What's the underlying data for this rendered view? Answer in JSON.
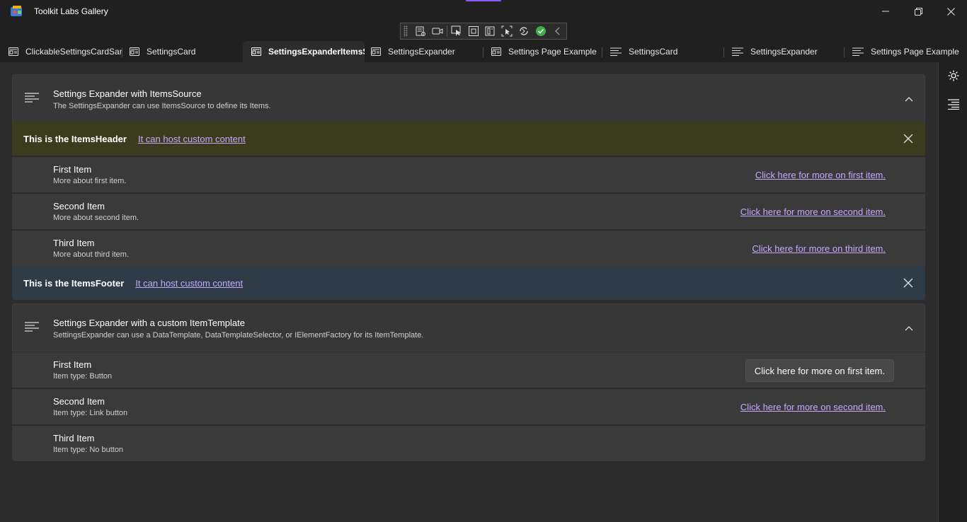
{
  "window": {
    "title": "Toolkit Labs Gallery"
  },
  "tabs": [
    {
      "label": "ClickableSettingsCardSar"
    },
    {
      "label": "SettingsCard"
    },
    {
      "label": "SettingsExpanderItemsS"
    },
    {
      "label": "SettingsExpander"
    },
    {
      "label": "Settings Page Example"
    },
    {
      "label": "SettingsCard"
    },
    {
      "label": "SettingsExpander"
    },
    {
      "label": "Settings Page Example"
    }
  ],
  "expander1": {
    "title": "Settings Expander with ItemsSource",
    "description": "The SettingsExpander can use ItemsSource to define its Items.",
    "header_banner": {
      "strong": "This is the ItemsHeader",
      "link": "It can host custom content"
    },
    "items": [
      {
        "title": "First Item",
        "desc": "More about first item.",
        "link": "Click here for more on first item."
      },
      {
        "title": "Second Item",
        "desc": "More about second item.",
        "link": "Click here for more on second item."
      },
      {
        "title": "Third Item",
        "desc": "More about third item.",
        "link": "Click here for more on third item."
      }
    ],
    "footer_banner": {
      "strong": "This is the ItemsFooter",
      "link": "It can host custom content"
    }
  },
  "expander2": {
    "title": "Settings Expander with a custom ItemTemplate",
    "description": "SettingsExpander can use a DataTemplate, DataTemplateSelector, or IElementFactory for its ItemTemplate.",
    "items": [
      {
        "title": "First Item",
        "desc": "Item type: Button",
        "button": "Click here for more on first item."
      },
      {
        "title": "Second Item",
        "desc": "Item type: Link button",
        "link": "Click here for more on second item."
      },
      {
        "title": "Third Item",
        "desc": "Item type: No button"
      }
    ]
  },
  "colors": {
    "accent": "#8a5cf5",
    "link": "#c6a9ff",
    "header_banner_bg": "#3b3b1d",
    "footer_banner_bg": "#2f3b47"
  }
}
